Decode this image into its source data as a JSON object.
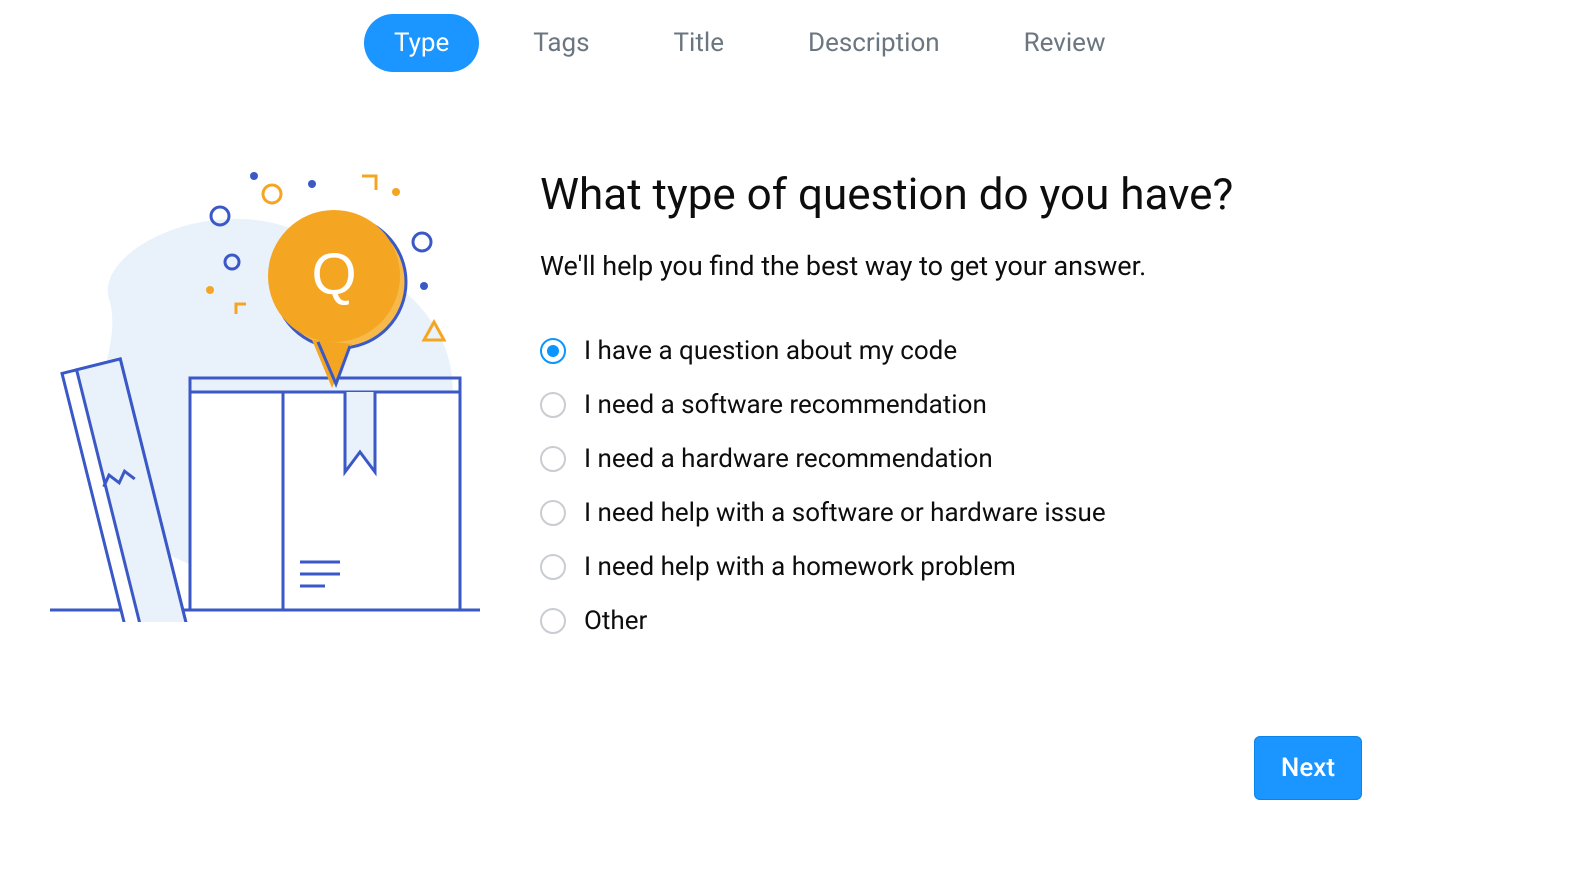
{
  "steps": [
    {
      "label": "Type",
      "active": true
    },
    {
      "label": "Tags",
      "active": false
    },
    {
      "label": "Title",
      "active": false
    },
    {
      "label": "Description",
      "active": false
    },
    {
      "label": "Review",
      "active": false
    }
  ],
  "main": {
    "title": "What type of question do you have?",
    "subtitle": "We'll help you find the best way to get your answer."
  },
  "options": [
    {
      "label": "I have a question about my code",
      "selected": true
    },
    {
      "label": "I need a software recommendation",
      "selected": false
    },
    {
      "label": "I need a hardware recommendation",
      "selected": false
    },
    {
      "label": "I need help with a software or hardware issue",
      "selected": false
    },
    {
      "label": "I need help with a homework problem",
      "selected": false
    },
    {
      "label": "Other",
      "selected": false
    }
  ],
  "buttons": {
    "next": "Next"
  },
  "illustration": {
    "q_letter": "Q"
  },
  "colors": {
    "accent": "#1b95ff",
    "radio_selected": "#0a95ff",
    "step_inactive": "#6b7680",
    "orange": "#f4a623",
    "illus_blue": "#3a59c6",
    "illus_light": "#e9f1fb"
  }
}
